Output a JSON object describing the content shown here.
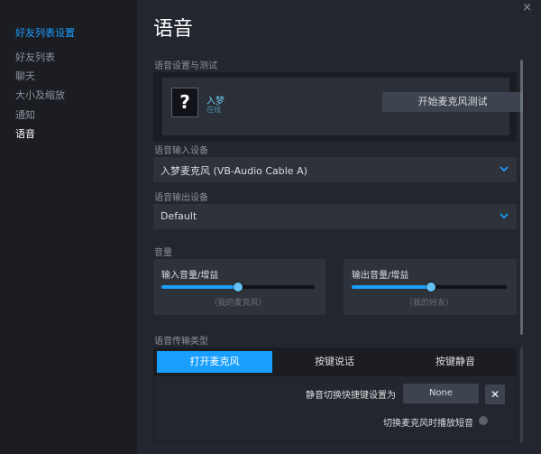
{
  "sidebar": {
    "header": "好友列表设置",
    "items": [
      {
        "label": "好友列表",
        "active": false
      },
      {
        "label": "聊天",
        "active": false
      },
      {
        "label": "大小及缩放",
        "active": false
      },
      {
        "label": "通知",
        "active": false
      },
      {
        "label": "语音",
        "active": true
      }
    ]
  },
  "main": {
    "close": "×",
    "title": "语音",
    "test_section": {
      "label": "语音设置与测试",
      "avatar_glyph": "?",
      "friend_name": "入梦",
      "friend_status": "在线",
      "button": "开始麦克风测试"
    },
    "input_device": {
      "label": "语音输入设备",
      "value": "入梦麦克风 (VB-Audio Cable A)"
    },
    "output_device": {
      "label": "语音输出设备",
      "value": "Default"
    },
    "volume": {
      "label": "音量",
      "input": {
        "label": "输入音量/增益",
        "caption": "（我的麦克风）",
        "level": 0.5
      },
      "output": {
        "label": "输出音量/增益",
        "caption": "（我的好友）",
        "level": 0.51
      }
    },
    "transmission": {
      "label": "语音传输类型",
      "tabs": [
        {
          "label": "打开麦克风",
          "active": true
        },
        {
          "label": "按键说话",
          "active": false
        },
        {
          "label": "按键静音",
          "active": false
        }
      ],
      "hotkey_label": "静音切换快捷键设置为",
      "hotkey_value": "None",
      "clear_glyph": "✕",
      "toggle_label": "切换麦克风时播放短音",
      "toggle_on": false
    }
  },
  "colors": {
    "accent": "#1a9fff",
    "background": "#23262e",
    "sidebar": "#1b1d23"
  }
}
